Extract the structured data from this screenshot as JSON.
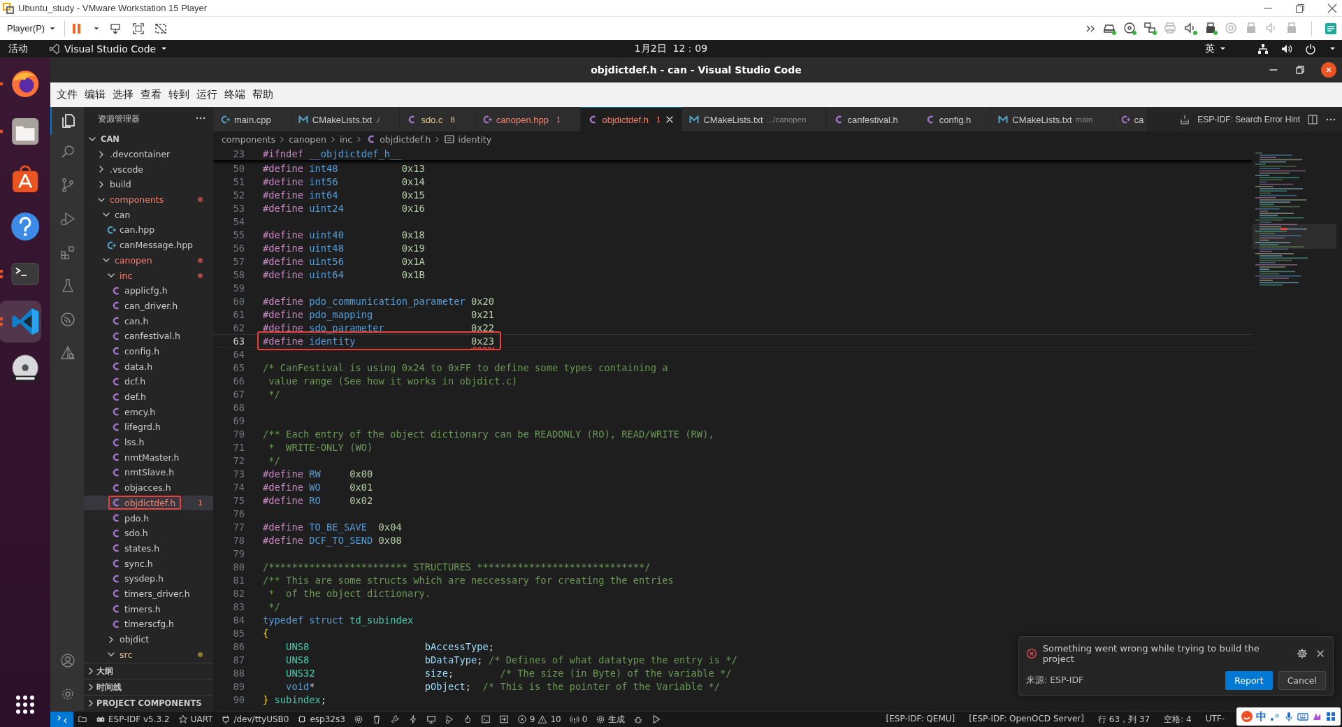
{
  "vm": {
    "title": "Ubuntu_study - VMware Workstation 15 Player",
    "player_menu": "Player(P)",
    "devices": [
      {
        "kind": "disk",
        "connected": true
      },
      {
        "kind": "disc",
        "connected": true
      },
      {
        "kind": "network",
        "connected": true
      },
      {
        "kind": "printer",
        "connected": false
      },
      {
        "kind": "sound",
        "connected": true
      },
      {
        "kind": "usb",
        "connected": true
      },
      {
        "kind": "camera",
        "connected": false
      },
      {
        "kind": "usb",
        "connected": false
      },
      {
        "kind": "sound",
        "connected": false
      },
      {
        "kind": "usb",
        "connected": false
      }
    ]
  },
  "topbar": {
    "activities": "活动",
    "app": "Visual Studio Code",
    "clock": "1月2日  12：09",
    "input_method": "英"
  },
  "dock": [
    {
      "kind": "browser",
      "running": true,
      "multiple_windows": false,
      "selected": false
    },
    {
      "kind": "files",
      "running": true,
      "multiple_windows": false,
      "selected": false
    },
    {
      "kind": "store",
      "running": false,
      "selected": false
    },
    {
      "kind": "help",
      "running": false,
      "selected": false
    },
    {
      "kind": "terminal",
      "running": true,
      "multiple_windows": true,
      "selected": false
    },
    {
      "kind": "editor",
      "running": true,
      "multiple_windows": true,
      "selected": true
    },
    {
      "kind": "dvd",
      "running": false,
      "selected": false
    }
  ],
  "vscode": {
    "title": "objdictdef.h - can - Visual Studio Code",
    "menu": [
      "文件",
      "编辑",
      "选择",
      "查看",
      "转到",
      "运行",
      "终端",
      "帮助"
    ],
    "activity": [
      {
        "kind": "explorer",
        "selected": true
      },
      {
        "kind": "search",
        "selected": false
      },
      {
        "kind": "source-control",
        "selected": false
      },
      {
        "kind": "run-debug",
        "selected": false
      },
      {
        "kind": "extensions",
        "selected": false
      },
      {
        "kind": "testing",
        "selected": false
      },
      {
        "kind": "esp-idf",
        "selected": false
      },
      {
        "kind": "idf-explorer",
        "selected": false
      }
    ],
    "activity_bottom": [
      {
        "kind": "account",
        "selected": false
      },
      {
        "kind": "settings",
        "selected": false
      }
    ],
    "sidebar": {
      "title": "资源管理器",
      "tree": {
        "label": "CAN",
        "kind": "root",
        "expanded": true,
        "error": false,
        "warning": false,
        "selected": false,
        "annotated": false,
        "children": [
          {
            "label": ".devcontainer",
            "kind": "folder",
            "expanded": false,
            "error": false,
            "warning": false,
            "selected": false,
            "annotated": false
          },
          {
            "label": ".vscode",
            "kind": "folder",
            "expanded": false,
            "error": false,
            "warning": false,
            "selected": false,
            "annotated": false
          },
          {
            "label": "build",
            "kind": "folder",
            "expanded": false,
            "error": false,
            "warning": false,
            "selected": false,
            "annotated": false
          },
          {
            "label": "components",
            "kind": "folder",
            "expanded": true,
            "error": true,
            "warning": false,
            "selected": false,
            "annotated": false,
            "children": [
              {
                "label": "can",
                "kind": "folder",
                "expanded": true,
                "error": false,
                "warning": false,
                "selected": false,
                "annotated": false,
                "children": [
                  {
                    "label": "can.hpp",
                    "kind": "cpp",
                    "error": false,
                    "warning": false,
                    "selected": false,
                    "annotated": false
                  },
                  {
                    "label": "canMessage.hpp",
                    "kind": "cpp",
                    "error": false,
                    "warning": false,
                    "selected": false,
                    "annotated": false
                  }
                ]
              },
              {
                "label": "canopen",
                "kind": "folder",
                "expanded": true,
                "error": true,
                "warning": false,
                "selected": false,
                "annotated": false,
                "children": [
                  {
                    "label": "inc",
                    "kind": "folder",
                    "expanded": true,
                    "error": true,
                    "warning": false,
                    "selected": false,
                    "annotated": false,
                    "children": [
                      {
                        "label": "applicfg.h",
                        "kind": "c",
                        "error": false,
                        "warning": false,
                        "selected": false,
                        "annotated": false
                      },
                      {
                        "label": "can_driver.h",
                        "kind": "c",
                        "error": false,
                        "warning": false,
                        "selected": false,
                        "annotated": false
                      },
                      {
                        "label": "can.h",
                        "kind": "c",
                        "error": false,
                        "warning": false,
                        "selected": false,
                        "annotated": false
                      },
                      {
                        "label": "canfestival.h",
                        "kind": "c",
                        "error": false,
                        "warning": false,
                        "selected": false,
                        "annotated": false
                      },
                      {
                        "label": "config.h",
                        "kind": "c",
                        "error": false,
                        "warning": false,
                        "selected": false,
                        "annotated": false
                      },
                      {
                        "label": "data.h",
                        "kind": "c",
                        "error": false,
                        "warning": false,
                        "selected": false,
                        "annotated": false
                      },
                      {
                        "label": "dcf.h",
                        "kind": "c",
                        "error": false,
                        "warning": false,
                        "selected": false,
                        "annotated": false
                      },
                      {
                        "label": "def.h",
                        "kind": "c",
                        "error": false,
                        "warning": false,
                        "selected": false,
                        "annotated": false
                      },
                      {
                        "label": "emcy.h",
                        "kind": "c",
                        "error": false,
                        "warning": false,
                        "selected": false,
                        "annotated": false
                      },
                      {
                        "label": "lifegrd.h",
                        "kind": "c",
                        "error": false,
                        "warning": false,
                        "selected": false,
                        "annotated": false
                      },
                      {
                        "label": "lss.h",
                        "kind": "c",
                        "error": false,
                        "warning": false,
                        "selected": false,
                        "annotated": false
                      },
                      {
                        "label": "nmtMaster.h",
                        "kind": "c",
                        "error": false,
                        "warning": false,
                        "selected": false,
                        "annotated": false
                      },
                      {
                        "label": "nmtSlave.h",
                        "kind": "c",
                        "error": false,
                        "warning": false,
                        "selected": false,
                        "annotated": false
                      },
                      {
                        "label": "objacces.h",
                        "kind": "c",
                        "error": false,
                        "warning": false,
                        "selected": false,
                        "annotated": false
                      },
                      {
                        "label": "objdictdef.h",
                        "kind": "c",
                        "error": true,
                        "warning": false,
                        "badge": "1",
                        "selected": true,
                        "annotated": true
                      },
                      {
                        "label": "pdo.h",
                        "kind": "c",
                        "error": false,
                        "warning": false,
                        "selected": false,
                        "annotated": false
                      },
                      {
                        "label": "sdo.h",
                        "kind": "c",
                        "error": false,
                        "warning": false,
                        "selected": false,
                        "annotated": false
                      },
                      {
                        "label": "states.h",
                        "kind": "c",
                        "error": false,
                        "warning": false,
                        "selected": false,
                        "annotated": false
                      },
                      {
                        "label": "sync.h",
                        "kind": "c",
                        "error": false,
                        "warning": false,
                        "selected": false,
                        "annotated": false
                      },
                      {
                        "label": "sysdep.h",
                        "kind": "c",
                        "error": false,
                        "warning": false,
                        "selected": false,
                        "annotated": false
                      },
                      {
                        "label": "timers_driver.h",
                        "kind": "c",
                        "error": false,
                        "warning": false,
                        "selected": false,
                        "annotated": false
                      },
                      {
                        "label": "timers.h",
                        "kind": "c",
                        "error": false,
                        "warning": false,
                        "selected": false,
                        "annotated": false
                      },
                      {
                        "label": "timerscfg.h",
                        "kind": "c",
                        "error": false,
                        "warning": false,
                        "selected": false,
                        "annotated": false
                      }
                    ]
                  },
                  {
                    "label": "objdict",
                    "kind": "folder",
                    "expanded": false,
                    "error": false,
                    "warning": false,
                    "selected": false,
                    "annotated": false
                  },
                  {
                    "label": "src",
                    "kind": "folder",
                    "expanded": true,
                    "error": false,
                    "warning": true,
                    "selected": false,
                    "annotated": false
                  }
                ]
              }
            ]
          }
        ]
      },
      "sections": [
        "大纲",
        "时间线",
        "PROJECT COMPONENTS"
      ]
    },
    "tabs": [
      {
        "label": "main.cpp",
        "kind": "cpp",
        "error": false,
        "warning": false,
        "selected": false
      },
      {
        "label": "CMakeLists.txt",
        "detail": "./",
        "kind": "cmake",
        "error": false,
        "warning": false,
        "selected": false
      },
      {
        "label": "sdo.c",
        "badge": "8",
        "kind": "c",
        "error": false,
        "warning": true,
        "selected": false
      },
      {
        "label": "canopen.hpp",
        "badge": "1",
        "kind": "hpp",
        "error": true,
        "warning": false,
        "selected": false
      },
      {
        "label": "objdictdef.h",
        "badge": "1",
        "kind": "c",
        "error": true,
        "warning": false,
        "selected": true
      },
      {
        "label": "CMakeLists.txt",
        "detail": ".../canopen",
        "kind": "cmake",
        "error": false,
        "warning": false,
        "selected": false
      },
      {
        "label": "canfestival.h",
        "kind": "c",
        "error": false,
        "warning": false,
        "selected": false
      },
      {
        "label": "config.h",
        "kind": "c",
        "error": false,
        "warning": false,
        "selected": false
      },
      {
        "label": "CMakeLists.txt",
        "detail": "main",
        "kind": "cmake",
        "error": false,
        "warning": false,
        "selected": false
      },
      {
        "label": "ca",
        "kind": "hpp",
        "error": false,
        "warning": false,
        "selected": false
      }
    ],
    "tab_hint": "ESP-IDF: Search Error Hint",
    "breadcrumb": [
      {
        "kind": "folder",
        "text": "components"
      },
      {
        "kind": "folder",
        "text": "canopen"
      },
      {
        "kind": "folder",
        "text": "inc"
      },
      {
        "kind": "c",
        "text": "objdictdef.h"
      },
      {
        "kind": "symbol",
        "text": "identity"
      }
    ],
    "sticky_line": {
      "number": "23",
      "tokens": [
        {
          "kind": "keyword",
          "text": "#ifndef "
        },
        {
          "kind": "macro",
          "text": "__objdictdef_h__"
        }
      ]
    },
    "lines": [
      {
        "number": "50",
        "current": false,
        "annotated": false,
        "tokens": [
          {
            "kind": "keyword",
            "text": "#define "
          },
          {
            "kind": "macro",
            "text": "int48           "
          },
          {
            "kind": "number",
            "text": "0x13"
          }
        ]
      },
      {
        "number": "51",
        "current": false,
        "annotated": false,
        "tokens": [
          {
            "kind": "keyword",
            "text": "#define "
          },
          {
            "kind": "macro",
            "text": "int56           "
          },
          {
            "kind": "number",
            "text": "0x14"
          }
        ]
      },
      {
        "number": "52",
        "current": false,
        "annotated": false,
        "tokens": [
          {
            "kind": "keyword",
            "text": "#define "
          },
          {
            "kind": "macro",
            "text": "int64           "
          },
          {
            "kind": "number",
            "text": "0x15"
          }
        ]
      },
      {
        "number": "53",
        "current": false,
        "annotated": false,
        "tokens": [
          {
            "kind": "keyword",
            "text": "#define "
          },
          {
            "kind": "macro",
            "text": "uint24          "
          },
          {
            "kind": "number",
            "text": "0x16"
          }
        ]
      },
      {
        "number": "54",
        "current": false,
        "annotated": false
      },
      {
        "number": "55",
        "current": false,
        "annotated": false,
        "tokens": [
          {
            "kind": "keyword",
            "text": "#define "
          },
          {
            "kind": "macro",
            "text": "uint40          "
          },
          {
            "kind": "number",
            "text": "0x18"
          }
        ]
      },
      {
        "number": "56",
        "current": false,
        "annotated": false,
        "tokens": [
          {
            "kind": "keyword",
            "text": "#define "
          },
          {
            "kind": "macro",
            "text": "uint48          "
          },
          {
            "kind": "number",
            "text": "0x19"
          }
        ]
      },
      {
        "number": "57",
        "current": false,
        "annotated": false,
        "tokens": [
          {
            "kind": "keyword",
            "text": "#define "
          },
          {
            "kind": "macro",
            "text": "uint56          "
          },
          {
            "kind": "number",
            "text": "0x1A"
          }
        ]
      },
      {
        "number": "58",
        "current": false,
        "annotated": false,
        "tokens": [
          {
            "kind": "keyword",
            "text": "#define "
          },
          {
            "kind": "macro",
            "text": "uint64          "
          },
          {
            "kind": "number",
            "text": "0x1B"
          }
        ]
      },
      {
        "number": "59",
        "current": false,
        "annotated": false
      },
      {
        "number": "60",
        "current": false,
        "annotated": false,
        "tokens": [
          {
            "kind": "keyword",
            "text": "#define "
          },
          {
            "kind": "macro",
            "text": "pdo_communication_parameter "
          },
          {
            "kind": "number",
            "text": "0x20"
          }
        ]
      },
      {
        "number": "61",
        "current": false,
        "annotated": false,
        "tokens": [
          {
            "kind": "keyword",
            "text": "#define "
          },
          {
            "kind": "macro",
            "text": "pdo_mapping                 "
          },
          {
            "kind": "number",
            "text": "0x21"
          }
        ]
      },
      {
        "number": "62",
        "current": false,
        "annotated": false,
        "tokens": [
          {
            "kind": "keyword",
            "text": "#define "
          },
          {
            "kind": "macro",
            "text": "sdo_parameter               "
          },
          {
            "kind": "number",
            "text": "0x22"
          }
        ]
      },
      {
        "number": "63",
        "current": true,
        "annotated": true,
        "tokens": [
          {
            "kind": "keyword",
            "text": "#define "
          },
          {
            "kind": "macro",
            "text": "identity                    "
          },
          {
            "kind": "number-error",
            "text": "0x23"
          }
        ]
      },
      {
        "number": "64",
        "current": false,
        "annotated": false
      },
      {
        "number": "65",
        "current": false,
        "annotated": false,
        "tokens": [
          {
            "kind": "comment",
            "text": "/* CanFestival is using 0x24 to 0xFF to define some types containing a"
          }
        ]
      },
      {
        "number": "66",
        "current": false,
        "annotated": false,
        "tokens": [
          {
            "kind": "comment",
            "text": " value range (See how it works in objdict.c)"
          }
        ]
      },
      {
        "number": "67",
        "current": false,
        "annotated": false,
        "tokens": [
          {
            "kind": "comment",
            "text": " */"
          }
        ]
      },
      {
        "number": "68",
        "current": false,
        "annotated": false
      },
      {
        "number": "69",
        "current": false,
        "annotated": false
      },
      {
        "number": "70",
        "current": false,
        "annotated": false,
        "tokens": [
          {
            "kind": "comment",
            "text": "/** Each entry of the object dictionary can be READONLY (RO), READ/WRITE (RW),"
          }
        ]
      },
      {
        "number": "71",
        "current": false,
        "annotated": false,
        "tokens": [
          {
            "kind": "comment",
            "text": " *  WRITE-ONLY (WO)"
          }
        ]
      },
      {
        "number": "72",
        "current": false,
        "annotated": false,
        "tokens": [
          {
            "kind": "comment",
            "text": " */"
          }
        ]
      },
      {
        "number": "73",
        "current": false,
        "annotated": false,
        "tokens": [
          {
            "kind": "keyword",
            "text": "#define "
          },
          {
            "kind": "macro",
            "text": "RW     "
          },
          {
            "kind": "number",
            "text": "0x00"
          }
        ]
      },
      {
        "number": "74",
        "current": false,
        "annotated": false,
        "tokens": [
          {
            "kind": "keyword",
            "text": "#define "
          },
          {
            "kind": "macro",
            "text": "WO     "
          },
          {
            "kind": "number",
            "text": "0x01"
          }
        ]
      },
      {
        "number": "75",
        "current": false,
        "annotated": false,
        "tokens": [
          {
            "kind": "keyword",
            "text": "#define "
          },
          {
            "kind": "macro",
            "text": "RO     "
          },
          {
            "kind": "number",
            "text": "0x02"
          }
        ]
      },
      {
        "number": "76",
        "current": false,
        "annotated": false
      },
      {
        "number": "77",
        "current": false,
        "annotated": false,
        "tokens": [
          {
            "kind": "keyword",
            "text": "#define "
          },
          {
            "kind": "macro",
            "text": "TO_BE_SAVE  "
          },
          {
            "kind": "number",
            "text": "0x04"
          }
        ]
      },
      {
        "number": "78",
        "current": false,
        "annotated": false,
        "tokens": [
          {
            "kind": "keyword",
            "text": "#define "
          },
          {
            "kind": "macro",
            "text": "DCF_TO_SEND "
          },
          {
            "kind": "number",
            "text": "0x08"
          }
        ]
      },
      {
        "number": "79",
        "current": false,
        "annotated": false
      },
      {
        "number": "80",
        "current": false,
        "annotated": false,
        "tokens": [
          {
            "kind": "comment",
            "text": "/************************ STRUCTURES *****************************/"
          }
        ]
      },
      {
        "number": "81",
        "current": false,
        "annotated": false,
        "tokens": [
          {
            "kind": "comment",
            "text": "/** This are some structs which are neccessary for creating the entries"
          }
        ]
      },
      {
        "number": "82",
        "current": false,
        "annotated": false,
        "tokens": [
          {
            "kind": "comment",
            "text": " *  of the object dictionary."
          }
        ]
      },
      {
        "number": "83",
        "current": false,
        "annotated": false,
        "tokens": [
          {
            "kind": "comment",
            "text": " */"
          }
        ]
      },
      {
        "number": "84",
        "current": false,
        "annotated": false,
        "tokens": [
          {
            "kind": "storage",
            "text": "typedef struct "
          },
          {
            "kind": "type",
            "text": "td_subindex"
          }
        ]
      },
      {
        "number": "85",
        "current": false,
        "annotated": false,
        "tokens": [
          {
            "kind": "brace",
            "text": "{"
          }
        ]
      },
      {
        "number": "86",
        "current": false,
        "annotated": false,
        "tokens": [
          {
            "kind": "type",
            "text": "    UNS8                    "
          },
          {
            "kind": "variable",
            "text": "bAccessType"
          },
          {
            "kind": "plain",
            "text": ";"
          }
        ]
      },
      {
        "number": "87",
        "current": false,
        "annotated": false,
        "tokens": [
          {
            "kind": "type",
            "text": "    UNS8                    "
          },
          {
            "kind": "variable",
            "text": "bDataType"
          },
          {
            "kind": "plain",
            "text": "; "
          },
          {
            "kind": "comment",
            "text": "/* Defines of what datatype the entry is */"
          }
        ]
      },
      {
        "number": "88",
        "current": false,
        "annotated": false,
        "tokens": [
          {
            "kind": "type",
            "text": "    UNS32                   "
          },
          {
            "kind": "variable",
            "text": "size"
          },
          {
            "kind": "plain",
            "text": ";        "
          },
          {
            "kind": "comment",
            "text": "/* The size (in Byte) of the variable */"
          }
        ]
      },
      {
        "number": "89",
        "current": false,
        "annotated": false,
        "tokens": [
          {
            "kind": "storage",
            "text": "    void"
          },
          {
            "kind": "plain",
            "text": "*                   "
          },
          {
            "kind": "variable",
            "text": "pObject"
          },
          {
            "kind": "plain",
            "text": ";  "
          },
          {
            "kind": "comment",
            "text": "/* This is the pointer of the Variable */"
          }
        ]
      },
      {
        "number": "90",
        "current": false,
        "annotated": false,
        "tokens": [
          {
            "kind": "brace",
            "text": "}"
          },
          {
            "kind": "type",
            "text": " subindex"
          },
          {
            "kind": "plain",
            "text": ";"
          }
        ]
      }
    ],
    "notification": {
      "message": "Something went wrong while trying to build the project",
      "source": "来源: ESP-IDF",
      "buttons": [
        {
          "label": "Report",
          "primary": true
        },
        {
          "label": "Cancel",
          "primary": false
        }
      ]
    },
    "status_bar": {
      "left": [
        {
          "kind": "folder"
        },
        {
          "kind": "board",
          "text": "ESP-IDF v5.3.2"
        },
        {
          "kind": "star",
          "text": "UART"
        },
        {
          "kind": "plug",
          "text": "/dev/ttyUSB0"
        },
        {
          "kind": "chip",
          "text": "esp32s3"
        },
        {
          "kind": "gear"
        },
        {
          "kind": "trash"
        },
        {
          "kind": "wrench"
        },
        {
          "kind": "bolt"
        },
        {
          "kind": "monitor"
        },
        {
          "kind": "debug"
        },
        {
          "kind": "flame"
        },
        {
          "kind": "terminal"
        },
        {
          "kind": "export"
        },
        {
          "kind": "problems",
          "errors": "9",
          "warnings": "10"
        },
        {
          "kind": "ports",
          "text": "0"
        },
        {
          "kind": "build",
          "text": "生成"
        },
        {
          "kind": "bug"
        },
        {
          "kind": "play"
        }
      ],
      "right": [
        "[ESP-IDF: QEMU]",
        "[ESP-IDF: OpenOCD Server]",
        "行 63，列 37",
        "空格: 4",
        "UTF-"
      ]
    },
    "ime": {
      "mode": "中"
    }
  }
}
